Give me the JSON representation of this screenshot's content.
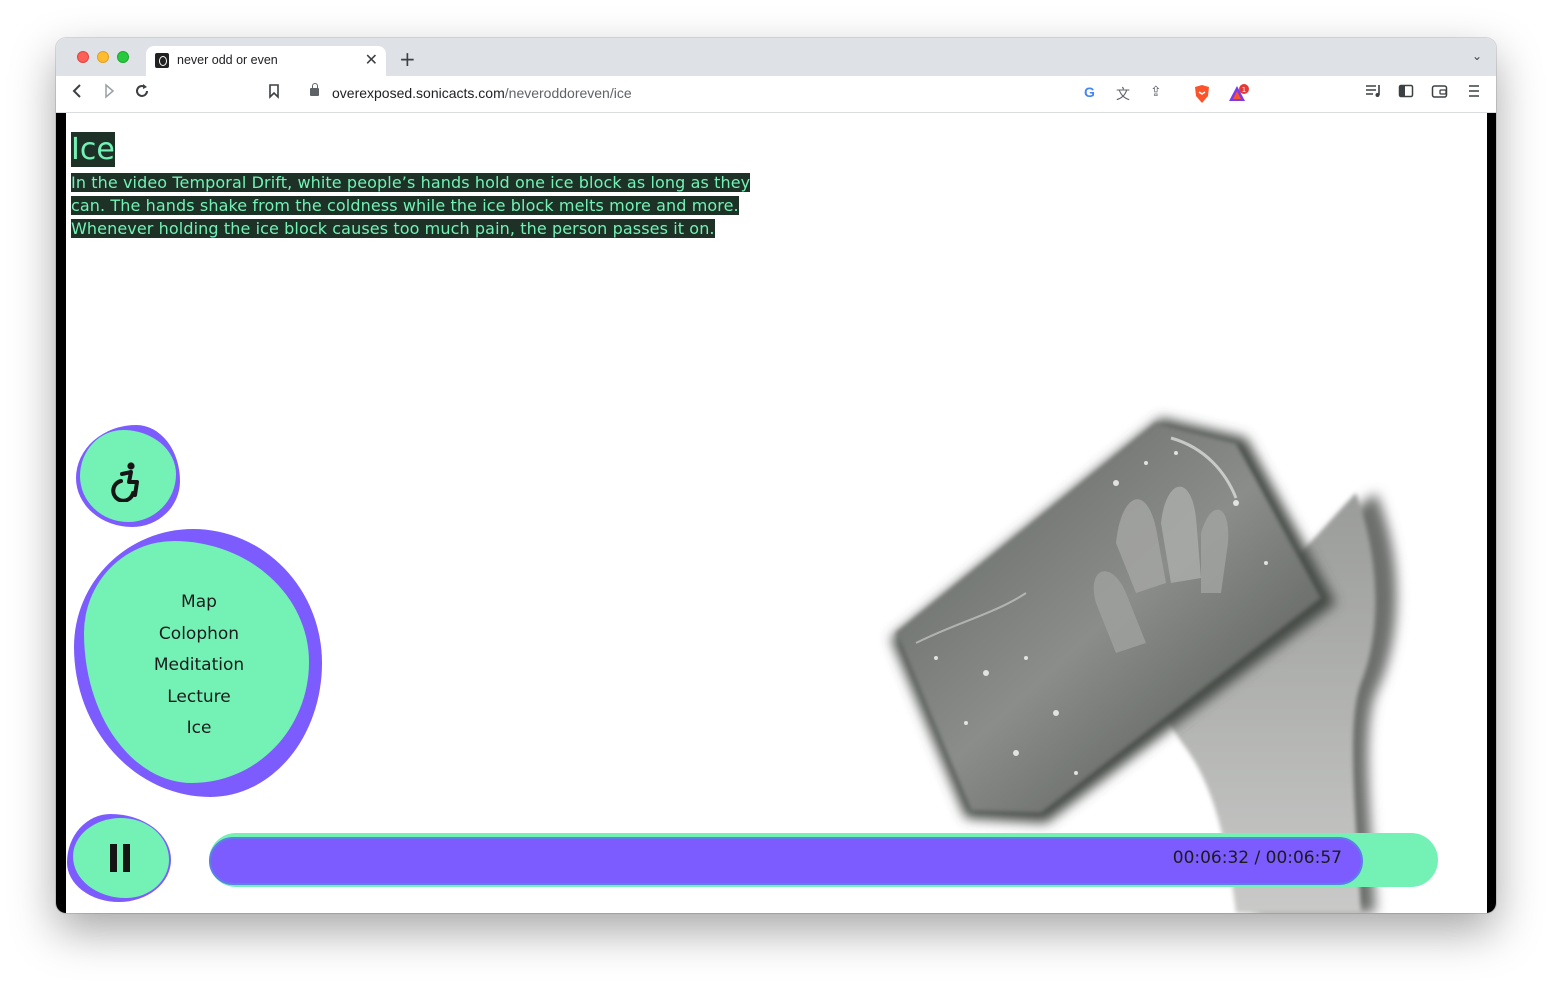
{
  "browser": {
    "tab_title": "never odd or even",
    "url_domain": "overexposed.sonicacts.com",
    "url_path": "/neveroddoreven/ice",
    "notification_count": "1"
  },
  "page": {
    "title": "Ice",
    "description": "In the video Temporal Drift, white people’s hands hold one ice block as long as they can. The hands shake from the coldness while the ice block melts more and more. Whenever holding the ice block causes too much pain, the person passes it on."
  },
  "menu": {
    "items": [
      "Map",
      "Colophon",
      "Meditation",
      "Lecture",
      "Ice"
    ]
  },
  "player": {
    "time_label": "00:06:32 / 00:06:57",
    "progress_fraction": 0.939
  },
  "colors": {
    "accent_green": "#74f2b6",
    "accent_purple": "#7c5cff",
    "text_highlight_bg": "#1d3127"
  },
  "icons": {
    "accessibility": "accessibility-icon",
    "pause": "pause-icon"
  }
}
